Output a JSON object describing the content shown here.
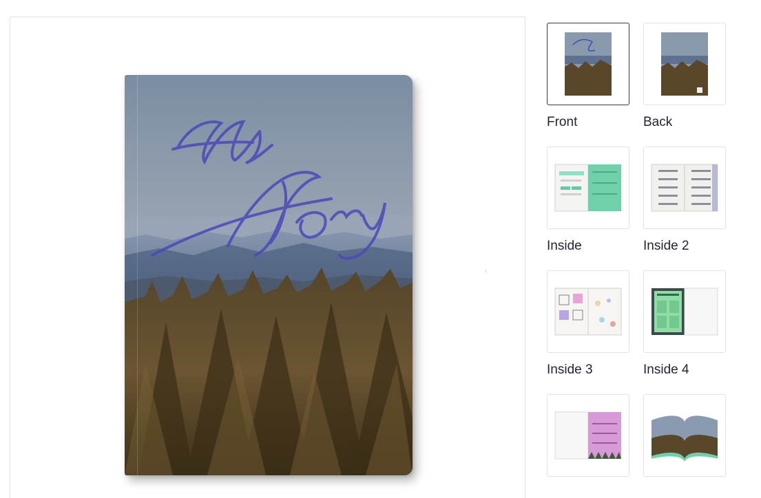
{
  "product": {
    "cover_title_line1": "My",
    "cover_title_line2": "Story"
  },
  "colors": {
    "title_ink": "#4a49b8",
    "sky_top": "#7e90a4",
    "sky_bottom": "#c7b9ad",
    "mountain": "#5f7391",
    "forest": "#4b3a20",
    "inside_green": "#6fd1a9",
    "inside_pink": "#d79ad7"
  },
  "thumbnails": [
    {
      "label": "Front",
      "selected": true
    },
    {
      "label": "Back",
      "selected": false
    },
    {
      "label": "Inside",
      "selected": false
    },
    {
      "label": "Inside 2",
      "selected": false
    },
    {
      "label": "Inside 3",
      "selected": false
    },
    {
      "label": "Inside 4",
      "selected": false
    },
    {
      "label": "",
      "selected": false
    },
    {
      "label": "",
      "selected": false
    }
  ]
}
